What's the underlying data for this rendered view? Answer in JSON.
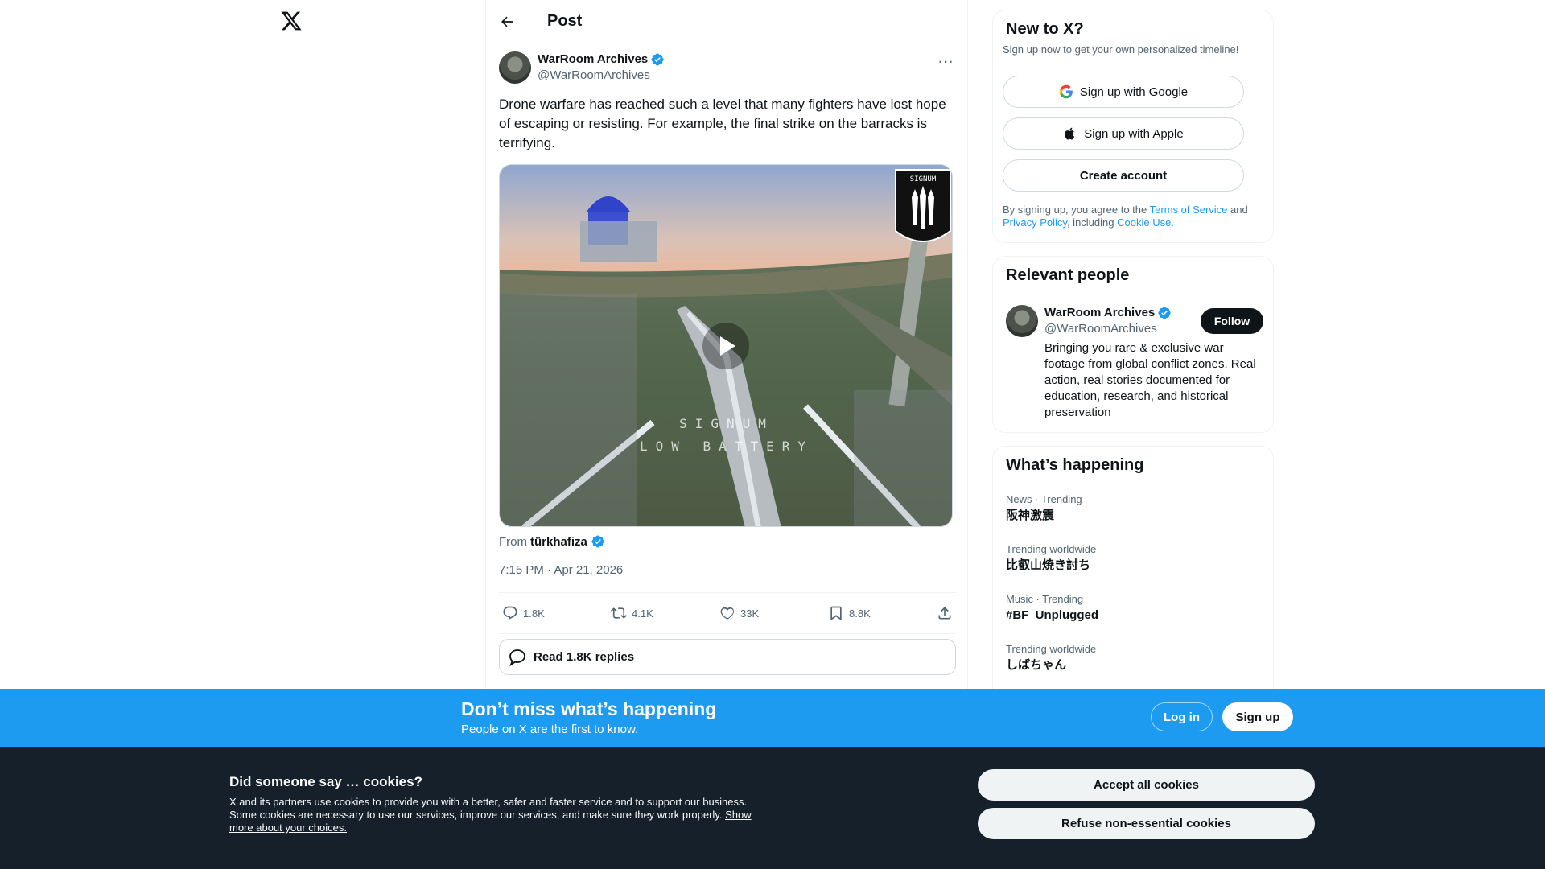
{
  "header": {
    "title": "Post"
  },
  "post": {
    "author_name": "WarRoom Archives",
    "author_handle": "@WarRoomArchives",
    "text": "Drone warfare has reached such a level that many fighters have lost hope of escaping or resisting. For example, the final strike on the barracks is terrifying.",
    "video_overlay_line1": "SIGNUM",
    "video_overlay_line2": "LOW BATTERY",
    "video_badge": "SIGNUM",
    "from_label": "From",
    "from_name": "türkhafiza",
    "timestamp": "7:15 PM · Apr 21, 2026",
    "stats": {
      "replies": "1.8K",
      "reposts": "4.1K",
      "likes": "33K",
      "bookmarks": "8.8K"
    },
    "read_replies": "Read 1.8K replies"
  },
  "sidebar": {
    "new_to_x": {
      "title": "New to X?",
      "subtitle": "Sign up now to get your own personalized timeline!",
      "google": "Sign up with Google",
      "apple": "Sign up with Apple",
      "create": "Create account",
      "legal_prefix": "By signing up, you agree to the ",
      "terms": "Terms of Service",
      "and": " and ",
      "privacy": "Privacy Policy",
      "including": ", including ",
      "cookie_use": "Cookie Use."
    },
    "relevant_people": {
      "title": "Relevant people",
      "name": "WarRoom Archives",
      "handle": "@WarRoomArchives",
      "follow": "Follow",
      "bio": "Bringing you rare & exclusive war footage from global conflict zones. Real action, real stories documented for education, research, and historical preservation"
    },
    "happening": {
      "title": "What’s happening",
      "trends": [
        {
          "meta": "News · Trending",
          "name": "阪神激震"
        },
        {
          "meta": "Trending worldwide",
          "name": "比叡山焼き討ち"
        },
        {
          "meta": "Music · Trending",
          "name": "#BF_Unplugged"
        },
        {
          "meta": "Trending worldwide",
          "name": "しばちゃん"
        }
      ]
    }
  },
  "banner": {
    "title": "Don’t miss what’s happening",
    "subtitle": "People on X are the first to know.",
    "login": "Log in",
    "signup": "Sign up"
  },
  "cookies": {
    "title": "Did someone say … cookies?",
    "text": "X and its partners use cookies to provide you with a better, safer and faster service and to support our business. Some cookies are necessary to use our services, improve our services, and make sure they work properly. ",
    "link": "Show more about your choices.",
    "accept": "Accept all cookies",
    "refuse": "Refuse non-essential cookies"
  },
  "colors": {
    "accent": "#1d9bf0",
    "text": "#0f1419",
    "muted": "#536471",
    "cookie_bg": "#15202b"
  }
}
